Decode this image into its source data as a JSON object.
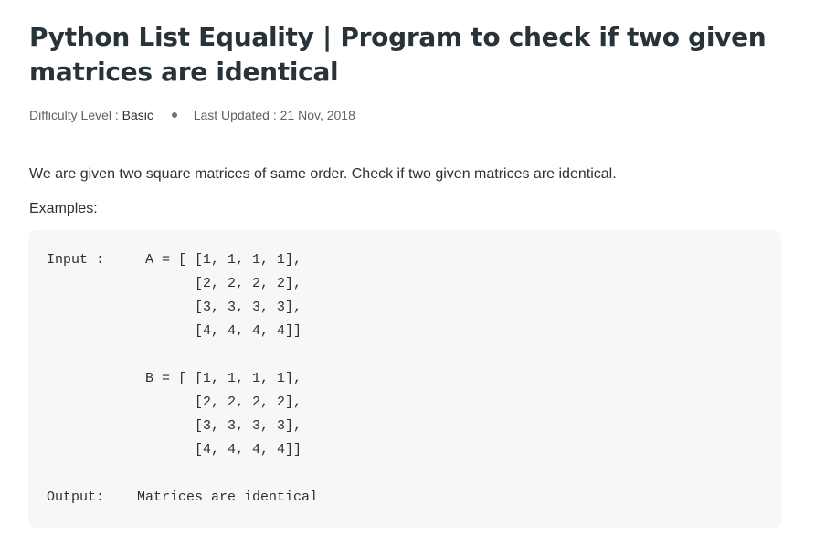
{
  "article": {
    "title": "Python List Equality | Program to check if two given matrices are identical",
    "meta": {
      "difficulty_label": "Difficulty Level : ",
      "difficulty_value": "Basic",
      "updated_label": "Last Updated : 21 Nov, 2018"
    },
    "intro": "We are given two square matrices of same order. Check if two given matrices are identical.",
    "examples_label": "Examples:",
    "code": "Input :     A = [ [1, 1, 1, 1],\n                  [2, 2, 2, 2],\n                  [3, 3, 3, 3],\n                  [4, 4, 4, 4]]\n\n            B = [ [1, 1, 1, 1],\n                  [2, 2, 2, 2],\n                  [3, 3, 3, 3],\n                  [4, 4, 4, 4]]\n\nOutput:    Matrices are identical"
  },
  "colors": {
    "text": "#273239",
    "muted": "#5b6369",
    "code_background": "#f7f7f7"
  }
}
